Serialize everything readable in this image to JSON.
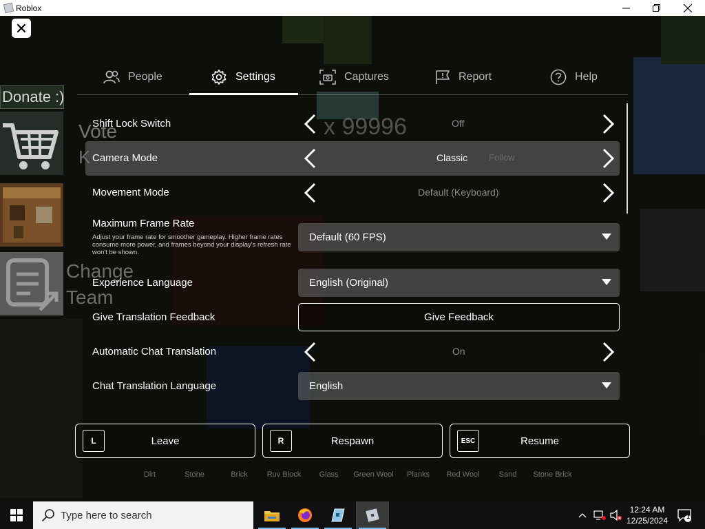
{
  "window": {
    "title": "Roblox",
    "controls": [
      "minimize",
      "maximize",
      "close"
    ]
  },
  "hud": {
    "donate_label": "Donate :)",
    "vote_label": "Vote",
    "change_team_label": [
      "Change",
      "Team"
    ],
    "counter_text": "x 99996",
    "hotbar": [
      "Dirt",
      "Stone",
      "Brick",
      "Ruv Block",
      "Glass",
      "Green Wool",
      "Planks",
      "Red Wool",
      "Sand",
      "Stone Brick"
    ]
  },
  "tabs": [
    {
      "label": "People",
      "icon": "people-icon",
      "active": false
    },
    {
      "label": "Settings",
      "icon": "gear-icon",
      "active": true
    },
    {
      "label": "Captures",
      "icon": "camera-icon",
      "active": false
    },
    {
      "label": "Report",
      "icon": "flag-icon",
      "active": false
    },
    {
      "label": "Help",
      "icon": "help-icon",
      "active": false
    }
  ],
  "settings": {
    "shift_lock": {
      "label": "Shift Lock Switch",
      "value": "Off"
    },
    "camera_mode": {
      "label": "Camera Mode",
      "value": "Classic",
      "next_value": "Follow"
    },
    "movement_mode": {
      "label": "Movement Mode",
      "value": "Default (Keyboard)"
    },
    "frame_rate": {
      "label": "Maximum Frame Rate",
      "description": "Adjust your frame rate for smoother gameplay. Higher frame rates consume more power, and frames beyond your display's refresh rate won't be shown.",
      "value": "Default (60 FPS)"
    },
    "experience_language": {
      "label": "Experience Language",
      "value": "English (Original)"
    },
    "translation_feedback": {
      "label": "Give Translation Feedback",
      "button": "Give Feedback"
    },
    "auto_chat_translation": {
      "label": "Automatic Chat Translation",
      "value": "On"
    },
    "chat_translation_language": {
      "label": "Chat Translation Language",
      "value": "English"
    }
  },
  "bottom_buttons": {
    "leave": {
      "key": "L",
      "label": "Leave"
    },
    "respawn": {
      "key": "R",
      "label": "Respawn"
    },
    "resume": {
      "key": "ESC",
      "label": "Resume"
    }
  },
  "taskbar": {
    "search_placeholder": "Type here to search",
    "apps": [
      "file-explorer-icon",
      "firefox-icon",
      "roblox-studio-icon",
      "roblox-icon"
    ],
    "time": "12:24 AM",
    "date": "12/25/2024",
    "notification_count": "1"
  },
  "colors": {
    "menu_highlight": "#787878",
    "active_taskbar_indicator": "#76b9ed",
    "dimmed_text": "#8a8a8a"
  }
}
